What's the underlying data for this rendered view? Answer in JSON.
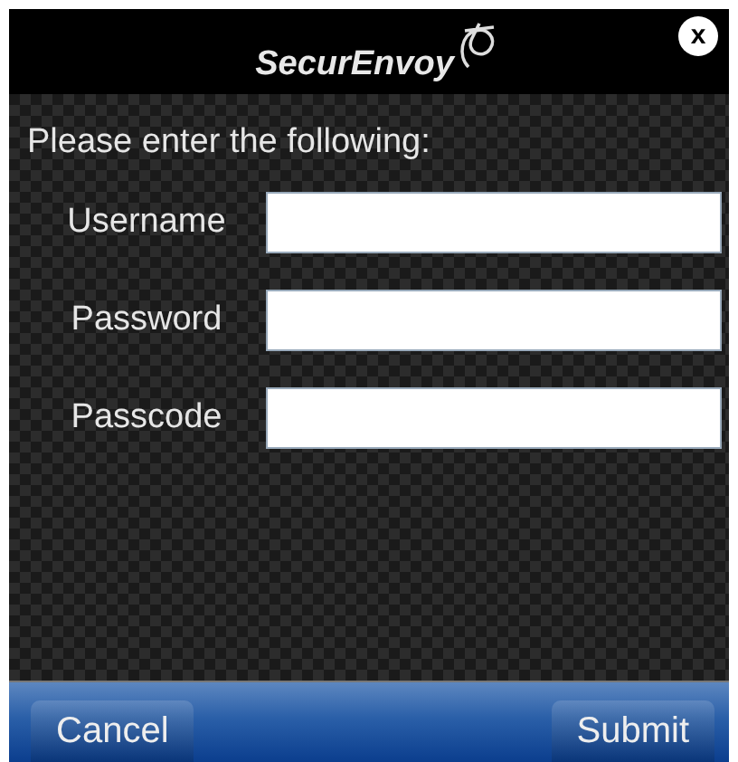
{
  "header": {
    "logo": "SecurEnvoy",
    "close": "x"
  },
  "prompt": "Please enter the following:",
  "fields": [
    {
      "label": "Username"
    },
    {
      "label": "Password"
    },
    {
      "label": "Passcode"
    }
  ],
  "buttons": {
    "cancel": "Cancel",
    "submit": "Submit"
  }
}
